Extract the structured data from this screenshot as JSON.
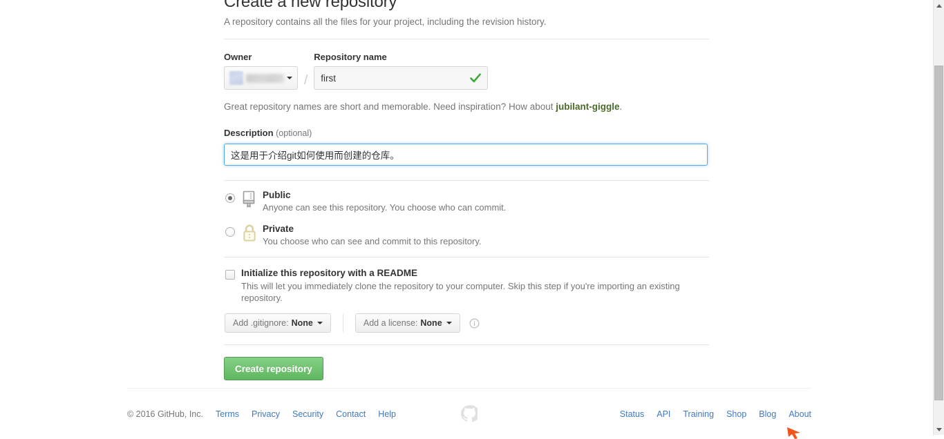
{
  "page": {
    "title": "Create a new repository",
    "subtitle": "A repository contains all the files for your project, including the revision history."
  },
  "form": {
    "owner": {
      "label": "Owner",
      "value": "",
      "icon": "chevron-down-icon"
    },
    "separator": "/",
    "repository": {
      "label": "Repository name",
      "value": "first",
      "placeholder": "",
      "valid_icon": "checkmark-icon"
    },
    "hint": {
      "text_before": "Great repository names are short and memorable. Need inspiration? How about ",
      "suggestion": "jubilant-giggle",
      "text_after": "."
    },
    "description": {
      "label": "Description",
      "optional": "(optional)",
      "value": "这是用于介绍git如何使用而创建的仓库。",
      "placeholder": ""
    },
    "visibility": {
      "options": [
        {
          "id": "public",
          "title": "Public",
          "description": "Anyone can see this repository. You choose who can commit.",
          "icon": "repo-book-icon",
          "selected": true
        },
        {
          "id": "private",
          "title": "Private",
          "description": "You choose who can see and commit to this repository.",
          "icon": "lock-icon",
          "selected": false
        }
      ]
    },
    "readme": {
      "title": "Initialize this repository with a README",
      "description": "This will let you immediately clone the repository to your computer. Skip this step if you're importing an existing repository.",
      "checked": false
    },
    "gitignore": {
      "label": "Add .gitignore:",
      "value": "None",
      "icon": "chevron-down-icon"
    },
    "license": {
      "label": "Add a license:",
      "value": "None",
      "icon": "chevron-down-icon"
    },
    "info_icon": "info-icon",
    "submit": {
      "label": "Create repository"
    }
  },
  "footer": {
    "copyright": "© 2016 GitHub, Inc.",
    "left_links": [
      "Terms",
      "Privacy",
      "Security",
      "Contact",
      "Help"
    ],
    "mark": "github-mark-icon",
    "right_links": [
      "Status",
      "API",
      "Training",
      "Shop",
      "Blog",
      "About"
    ]
  },
  "scrollbar": {
    "up_icon": "scroll-up-arrow-icon",
    "down_icon": "scroll-down-arrow-icon"
  },
  "colors": {
    "link": "#4078c0",
    "submit_green": "#60b760",
    "focus_blue": "#51a7e8",
    "check_green": "#3ca83c",
    "lock_gold": "#dfd8a8",
    "cursor_orange": "#f2561d"
  }
}
